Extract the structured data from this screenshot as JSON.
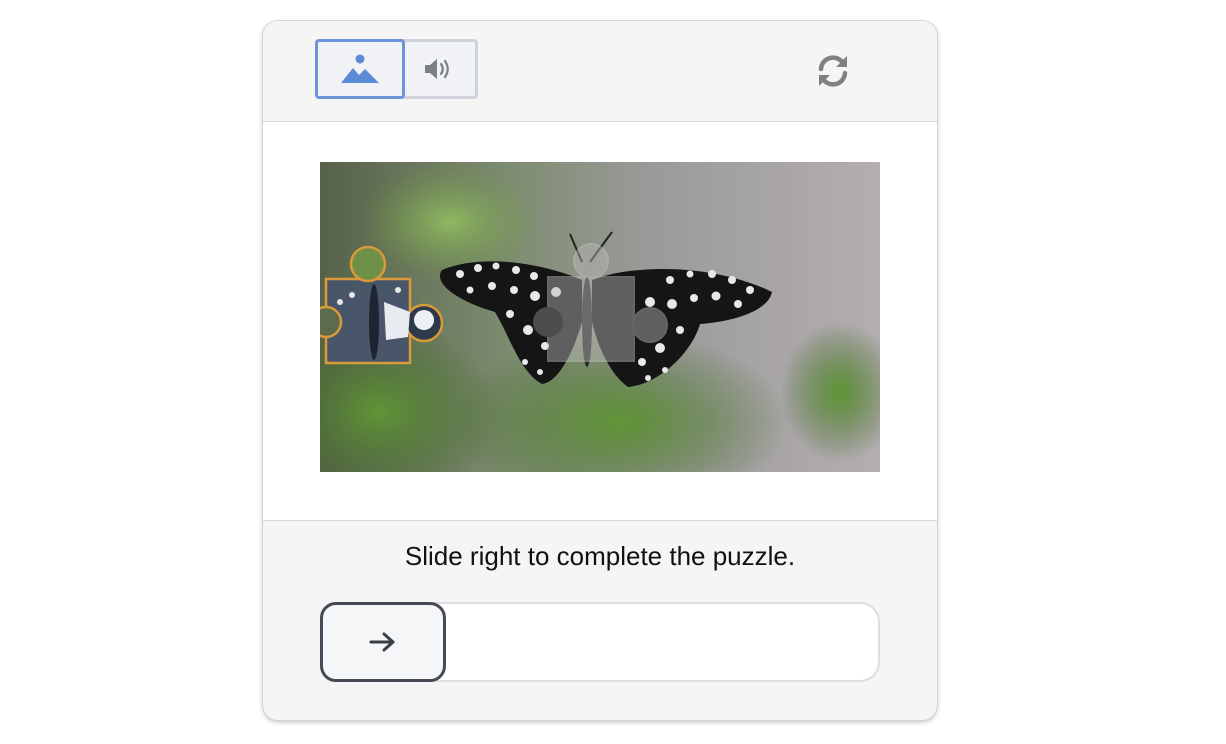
{
  "header": {
    "image_mode_icon": "image-icon",
    "audio_mode_icon": "speaker-icon",
    "refresh_icon": "refresh-icon"
  },
  "puzzle": {
    "subject": "butterfly on green plant",
    "piece_icon": "puzzle-piece",
    "slot_icon": "puzzle-slot"
  },
  "instruction": "Slide right to complete the puzzle.",
  "slider": {
    "handle_icon": "arrow-right-icon",
    "progress": 0
  },
  "colors": {
    "accent": "#6c95d8",
    "handle_border": "#454a54",
    "piece_outline": "#d99a3a"
  }
}
